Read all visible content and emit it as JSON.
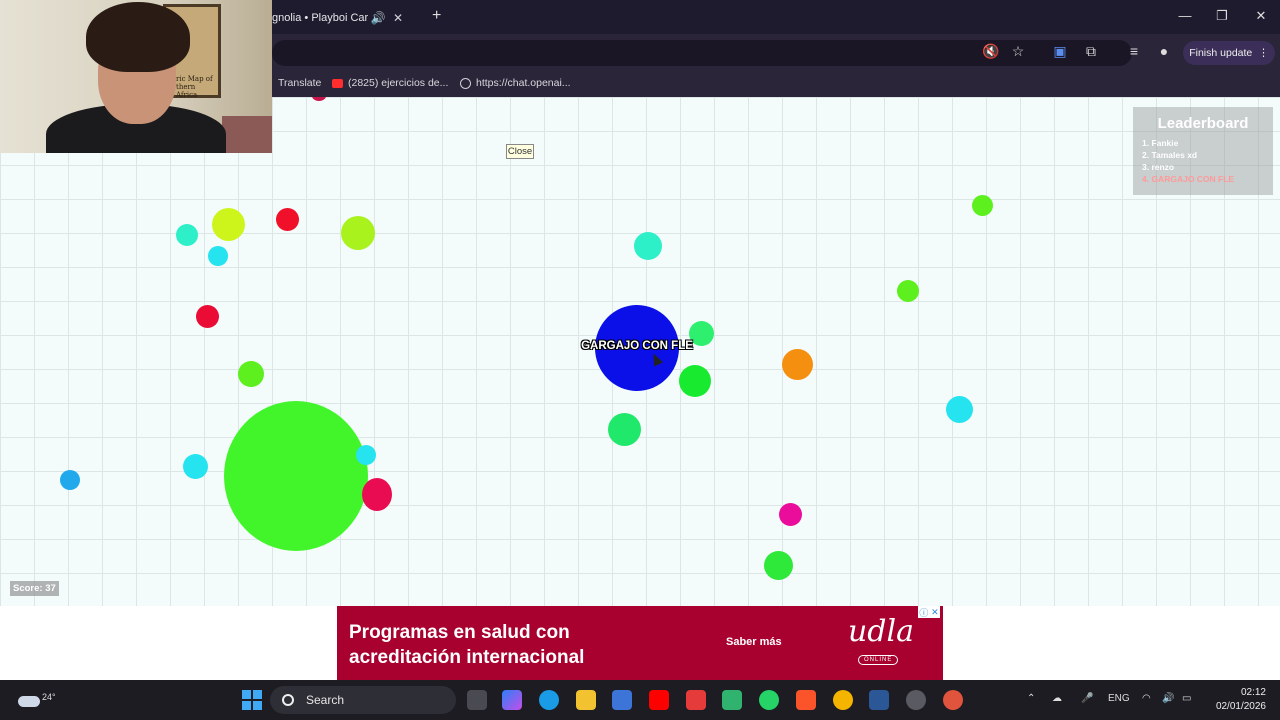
{
  "browser": {
    "tab_title": "gnolia • Playboi Carti",
    "tab_audio_icon": "speaker-icon",
    "tab_close_icon": "close-icon",
    "new_tab_icon": "plus-icon",
    "finish_update_label": "Finish update",
    "bookmarks": [
      {
        "label": "Translate"
      },
      {
        "label": "(2825) ejercicios de..."
      },
      {
        "label": "https://chat.openai..."
      }
    ]
  },
  "game": {
    "close_label": "Close",
    "player_name": "GARGAJO CON FLE",
    "player_color": "#0b10e8",
    "score_text": "Score: 37",
    "leaderboard": {
      "title": "Leaderboard",
      "entries": [
        "1. Fankie",
        "2. Tamales xd",
        "3. renzo",
        "4. GARGAJO CON FLE"
      ],
      "highlight_color": "#ff9a9a"
    },
    "background_color": "#f3fbfb",
    "virus_color": "#42f52a"
  },
  "ad": {
    "headline": "Programas en salud con acreditación internacional",
    "cta": "Saber más",
    "logo_text": "udla",
    "logo_sub": "ONLINE",
    "background_color": "#a8002f"
  },
  "webcam": {
    "map_text": "ric Map of thern Africa"
  },
  "taskbar": {
    "temperature": "24°",
    "search_label": "Search",
    "language": "ENG",
    "time": "02:12",
    "date": "02/01/2026"
  }
}
